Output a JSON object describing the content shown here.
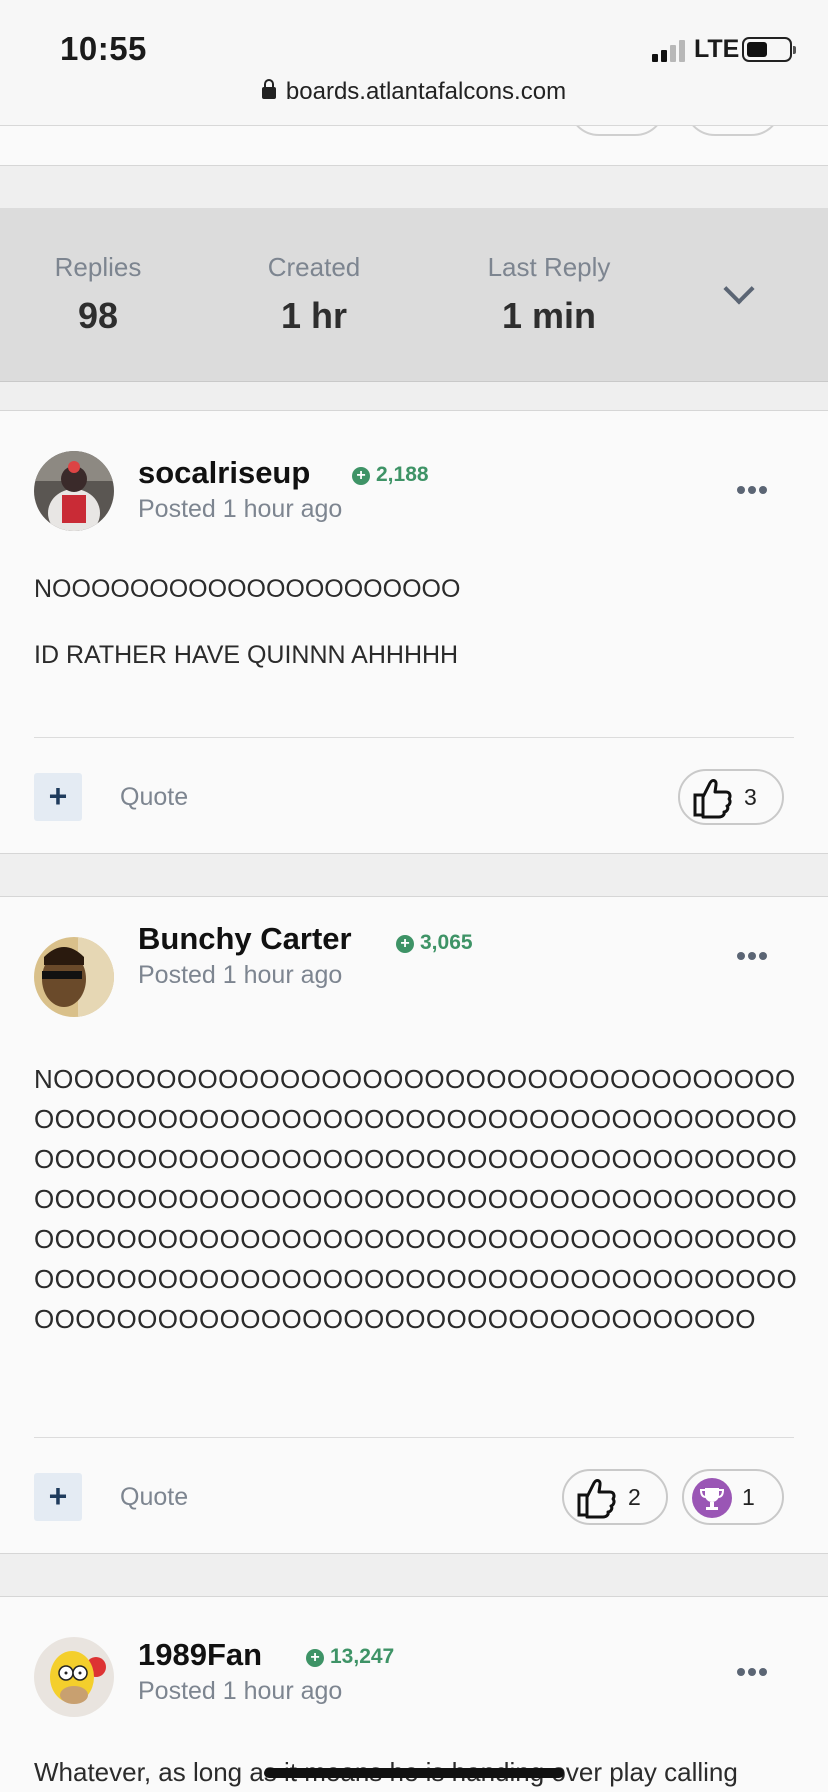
{
  "status_bar": {
    "time": "10:55",
    "network": "LTE"
  },
  "browser": {
    "url": "boards.atlantafalcons.com"
  },
  "topic_stats": [
    {
      "label": "Replies",
      "value": "98"
    },
    {
      "label": "Created",
      "value": "1 hr"
    },
    {
      "label": "Last Reply",
      "value": "1 min"
    }
  ],
  "posts": [
    {
      "author": "socalriseup",
      "reputation": "2,188",
      "posted": "Posted 1 hour ago",
      "lines": [
        "NOOOOOOOOOOOOOOOOOOOOO",
        "ID RATHER HAVE QUINNN AHHHHH"
      ],
      "quote_label": "Quote",
      "reactions": [
        {
          "type": "like",
          "count": "3"
        }
      ]
    },
    {
      "author": "Bunchy Carter",
      "reputation": "3,065",
      "posted": "Posted 1 hour ago",
      "text": "NOOOOOOOOOOOOOOOOOOOOOOOOOOOOOOOOOOOOOOOOOOOOOOOOOOOOOOOOOOOOOOOOOOOOOOOOOOOOOOOOOOOOOOOOOOOOOOOOOOOOOOOOOOOOOOOOOOOOOOOOOOOOOOOOOOOOOOOOOOOOOOOOOOOOOOOOOOOOOOOOOOOOOOOOOOOOOOOOOOOOOOOOOOOOOOOOOOOOOOOOOOOOOOOOOOOOOOOOOOOOOOOOOOOOOOOOOOOOOOOOOOOOOOOOOOOOOOOO",
      "quote_label": "Quote",
      "reactions": [
        {
          "type": "like",
          "count": "2"
        },
        {
          "type": "trophy",
          "count": "1"
        }
      ]
    },
    {
      "author": "1989Fan",
      "reputation": "13,247",
      "posted": "Posted 1 hour ago",
      "text": "Whatever, as long as it means he is handing over play calling"
    }
  ]
}
